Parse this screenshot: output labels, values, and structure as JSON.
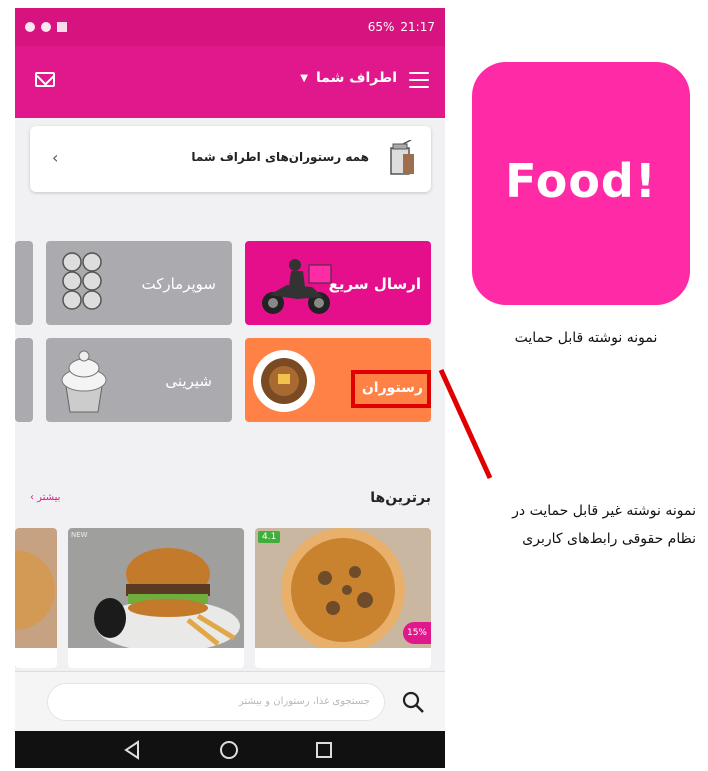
{
  "status_bar": {
    "battery": "65%",
    "time": "21:17"
  },
  "app_bar": {
    "location_label": "اطراف شما",
    "dropdown_glyph": "⌄"
  },
  "all_restaurants": {
    "label": "همه رستوران‌های اطراف شما",
    "chevron": "‹"
  },
  "categories": [
    {
      "label": "ارسال سریع",
      "color": "#e60f8b"
    },
    {
      "label": "سوپرمارکت",
      "color": "#aaaaaf"
    },
    {
      "label": "رستوران",
      "color": "#ff8146"
    },
    {
      "label": "شیرینی",
      "color": "#aaaaaf"
    }
  ],
  "best": {
    "title": "برترین‌ها",
    "more_label": "بیشتر ›"
  },
  "cards": [
    {
      "rating": "4.1",
      "discount": "15%"
    },
    {
      "badge": "NEW"
    }
  ],
  "search": {
    "placeholder": "جستجوی غذا، رستوران و بیشتر"
  },
  "logo": {
    "text": "Food!",
    "color": "#ff2aa6"
  },
  "annotations": {
    "supported_caption": "نمونه نوشته قابل حمایت",
    "unsupported_caption_line1": "نمونه نوشته غیر قابل حمایت در",
    "unsupported_caption_line2": "نظام حقوقی رابط‌های کاربری",
    "highlight_color": "#e00000"
  },
  "icons": [
    "menu-icon",
    "mail-icon",
    "chevron-down-icon",
    "chevron-left-icon",
    "cup-icon",
    "search-icon",
    "back-icon",
    "home-icon",
    "recent-apps-icon"
  ]
}
